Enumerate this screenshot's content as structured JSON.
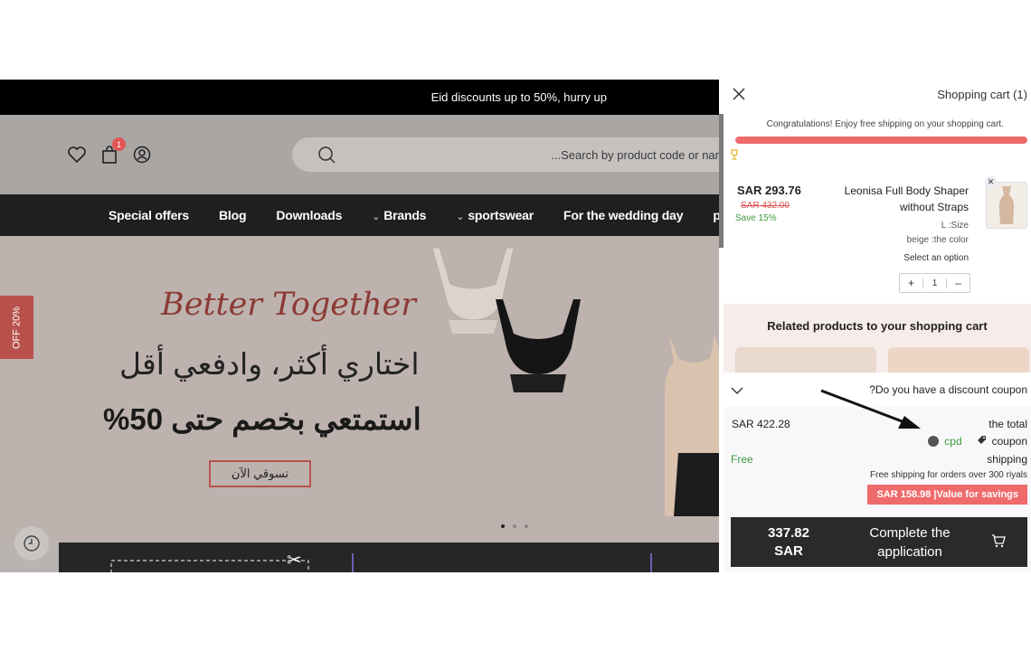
{
  "store": {
    "announcement": "Eid discounts up to 50%, hurry up",
    "cart_badge": "1",
    "search_placeholder": "...Search by product code or nar",
    "nav": [
      "Special offers",
      "Blog",
      "Downloads",
      "Brands",
      "sportswear",
      "For the wedding day",
      "panties"
    ],
    "off_tab": "OFF 20%",
    "hero": {
      "script_title": "Better Together",
      "line1": "اختاري أكثر، وادفعي أقل",
      "line2": "استمتعي بخصم حتى 50%",
      "shop_button": "تسوقي الآن"
    }
  },
  "cart": {
    "title": "Shopping cart  (1)",
    "congrats": "Congratulations! Enjoy free shipping on your shopping cart.",
    "free_shipping_progress": 1.0,
    "item": {
      "price": "SAR  293.76",
      "old_price": "SAR  432.00",
      "save": "Save 15%",
      "name": "Leonisa Full Body Shaper without Straps",
      "size": "L :Size",
      "color": "beige :the color",
      "select_option": "Select an option",
      "quantity": "1",
      "plus": "+",
      "minus": "–"
    },
    "related_title": "Related products to your shopping cart",
    "coupon_question": "?Do you have a discount coupon",
    "totals": {
      "total_amount": "SAR  422.28",
      "total_label": "the total",
      "coupon_code": "cpd",
      "coupon_label": "coupon",
      "shipping_value": "Free",
      "shipping_label": "shipping",
      "shipping_note": "Free shipping for orders over 300 riyals",
      "savings": "SAR  158.98 |Value for savings"
    },
    "checkout": {
      "amount": "337.82",
      "currency": "SAR",
      "label": "Complete the application"
    }
  },
  "colors": {
    "accent_red": "#ef6b6b",
    "green": "#3e9b3e",
    "dark": "#2a2a2a"
  }
}
